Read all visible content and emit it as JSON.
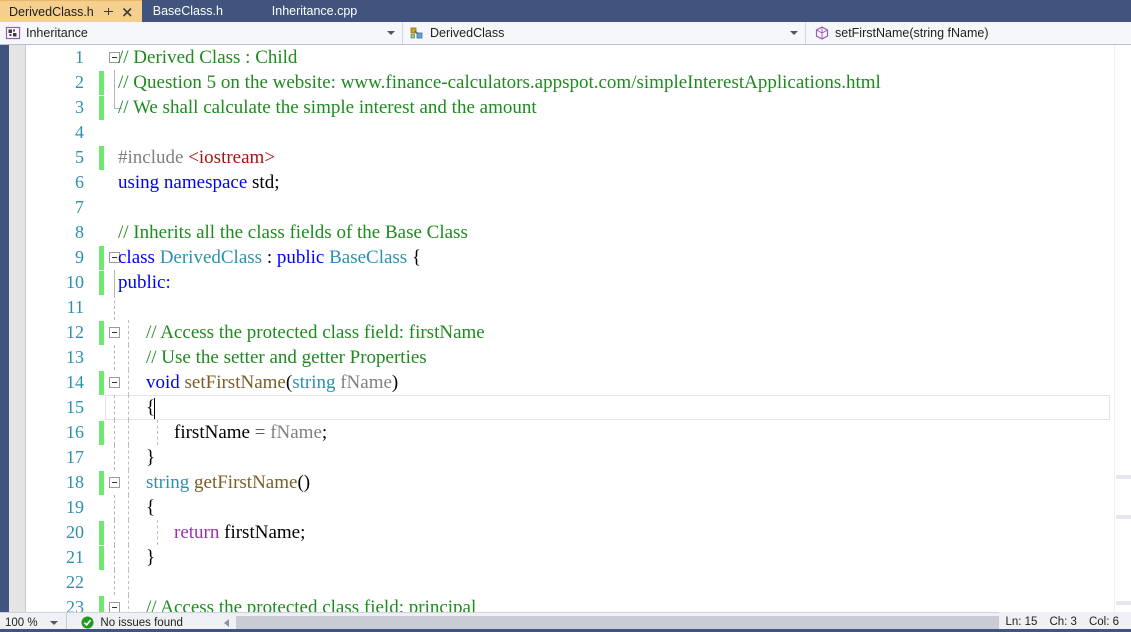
{
  "tabs": [
    {
      "label": "DerivedClass.h",
      "active": true,
      "pin_icon": "pin-icon",
      "close_icon": "close-icon"
    },
    {
      "label": "BaseClass.h",
      "active": false
    },
    {
      "label": "Inheritance.cpp",
      "active": false
    }
  ],
  "nav_bar": {
    "project": {
      "label": "Inheritance",
      "icon": "project-icon"
    },
    "type": {
      "label": "DerivedClass",
      "icon": "class-icon"
    },
    "member": {
      "label": "setFirstName(string fName)",
      "icon": "method-icon"
    }
  },
  "editor": {
    "current_line": 15,
    "lines": [
      {
        "n": 1,
        "change": false,
        "fold": "open",
        "indent": 0,
        "tokens": [
          {
            "t": "// Derived Class : Child",
            "c": "t-com"
          }
        ]
      },
      {
        "n": 2,
        "change": true,
        "fold": "bar",
        "indent": 0,
        "tokens": [
          {
            "t": "// Question 5 on the website: www.finance-calculators.appspot.com/simpleInterestApplications.html",
            "c": "t-com"
          }
        ]
      },
      {
        "n": 3,
        "change": true,
        "fold": "end",
        "indent": 0,
        "tokens": [
          {
            "t": "// We shall calculate the simple interest and the amount",
            "c": "t-com"
          }
        ]
      },
      {
        "n": 4,
        "change": false,
        "fold": "none",
        "indent": 0,
        "tokens": []
      },
      {
        "n": 5,
        "change": true,
        "fold": "none",
        "indent": 0,
        "tokens": [
          {
            "t": "#include ",
            "c": "t-pp"
          },
          {
            "t": "<iostream>",
            "c": "t-str"
          }
        ]
      },
      {
        "n": 6,
        "change": false,
        "fold": "none",
        "indent": 0,
        "tokens": [
          {
            "t": "using namespace ",
            "c": "t-kw"
          },
          {
            "t": "std;",
            "c": "t-plain"
          }
        ]
      },
      {
        "n": 7,
        "change": false,
        "fold": "none",
        "indent": 0,
        "tokens": []
      },
      {
        "n": 8,
        "change": false,
        "fold": "none",
        "indent": 0,
        "tokens": [
          {
            "t": "// Inherits all the class fields of the Base Class",
            "c": "t-com"
          }
        ]
      },
      {
        "n": 9,
        "change": true,
        "fold": "open",
        "indent": 0,
        "tokens": [
          {
            "t": "class ",
            "c": "t-kw"
          },
          {
            "t": "DerivedClass ",
            "c": "t-type"
          },
          {
            "t": ": ",
            "c": "t-plain"
          },
          {
            "t": "public ",
            "c": "t-kw"
          },
          {
            "t": "BaseClass ",
            "c": "t-type"
          },
          {
            "t": "{",
            "c": "t-plain"
          }
        ]
      },
      {
        "n": 10,
        "change": true,
        "fold": "vline",
        "indent": 0,
        "tokens": [
          {
            "t": "public:",
            "c": "t-kw"
          }
        ]
      },
      {
        "n": 11,
        "change": false,
        "fold": "vdash",
        "indent": 0,
        "tokens": []
      },
      {
        "n": 12,
        "change": true,
        "fold": "open2",
        "indent": 1,
        "tokens": [
          {
            "t": "// Access the protected class field: firstName",
            "c": "t-com"
          }
        ]
      },
      {
        "n": 13,
        "change": false,
        "fold": "vdash",
        "indent": 1,
        "tokens": [
          {
            "t": "// Use the setter and getter Properties",
            "c": "t-com"
          }
        ]
      },
      {
        "n": 14,
        "change": true,
        "fold": "open2",
        "indent": 1,
        "tokens": [
          {
            "t": "void ",
            "c": "t-kw"
          },
          {
            "t": "setFirstName",
            "c": "t-fn"
          },
          {
            "t": "(",
            "c": "t-plain"
          },
          {
            "t": "string ",
            "c": "t-type"
          },
          {
            "t": "fName",
            "c": "t-var"
          },
          {
            "t": ")",
            "c": "t-plain"
          }
        ]
      },
      {
        "n": 15,
        "change": false,
        "fold": "vdash",
        "indent": 1,
        "tokens": [
          {
            "t": "{",
            "c": "t-plain"
          }
        ]
      },
      {
        "n": 16,
        "change": true,
        "fold": "vdash",
        "indent": 2,
        "tokens": [
          {
            "t": "firstName ",
            "c": "t-plain"
          },
          {
            "t": "= ",
            "c": "t-op"
          },
          {
            "t": "fName",
            "c": "t-var"
          },
          {
            "t": ";",
            "c": "t-plain"
          }
        ]
      },
      {
        "n": 17,
        "change": false,
        "fold": "vdash",
        "indent": 1,
        "tokens": [
          {
            "t": "}",
            "c": "t-plain"
          }
        ]
      },
      {
        "n": 18,
        "change": true,
        "fold": "open2",
        "indent": 1,
        "tokens": [
          {
            "t": "string ",
            "c": "t-type"
          },
          {
            "t": "getFirstName",
            "c": "t-fn"
          },
          {
            "t": "()",
            "c": "t-plain"
          }
        ]
      },
      {
        "n": 19,
        "change": false,
        "fold": "vdash",
        "indent": 1,
        "tokens": [
          {
            "t": "{",
            "c": "t-plain"
          }
        ]
      },
      {
        "n": 20,
        "change": true,
        "fold": "vdash",
        "indent": 2,
        "tokens": [
          {
            "t": "return ",
            "c": "t-ret"
          },
          {
            "t": "firstName;",
            "c": "t-plain"
          }
        ]
      },
      {
        "n": 21,
        "change": true,
        "fold": "vdash",
        "indent": 1,
        "tokens": [
          {
            "t": "}",
            "c": "t-plain"
          }
        ]
      },
      {
        "n": 22,
        "change": false,
        "fold": "vdash",
        "indent": 1,
        "tokens": []
      },
      {
        "n": 23,
        "change": true,
        "fold": "open2",
        "indent": 1,
        "tokens": [
          {
            "t": "// Access the protected class field: principal",
            "c": "t-com"
          }
        ]
      }
    ]
  },
  "status": {
    "zoom": "100 %",
    "issues_icon": "check-circle-icon",
    "issues": "No issues found",
    "line": "Ln: 15",
    "char": "Ch: 3",
    "column": "Col: 6"
  },
  "colors": {
    "chrome": "#41547d",
    "active_tab": "#f5cf8e",
    "comment": "#1d8b1d",
    "keyword": "#0000ff",
    "type": "#2b91af",
    "string": "#a31515",
    "function": "#795e26",
    "return_kw": "#9b30b0",
    "change_bar": "#6ee86e"
  }
}
